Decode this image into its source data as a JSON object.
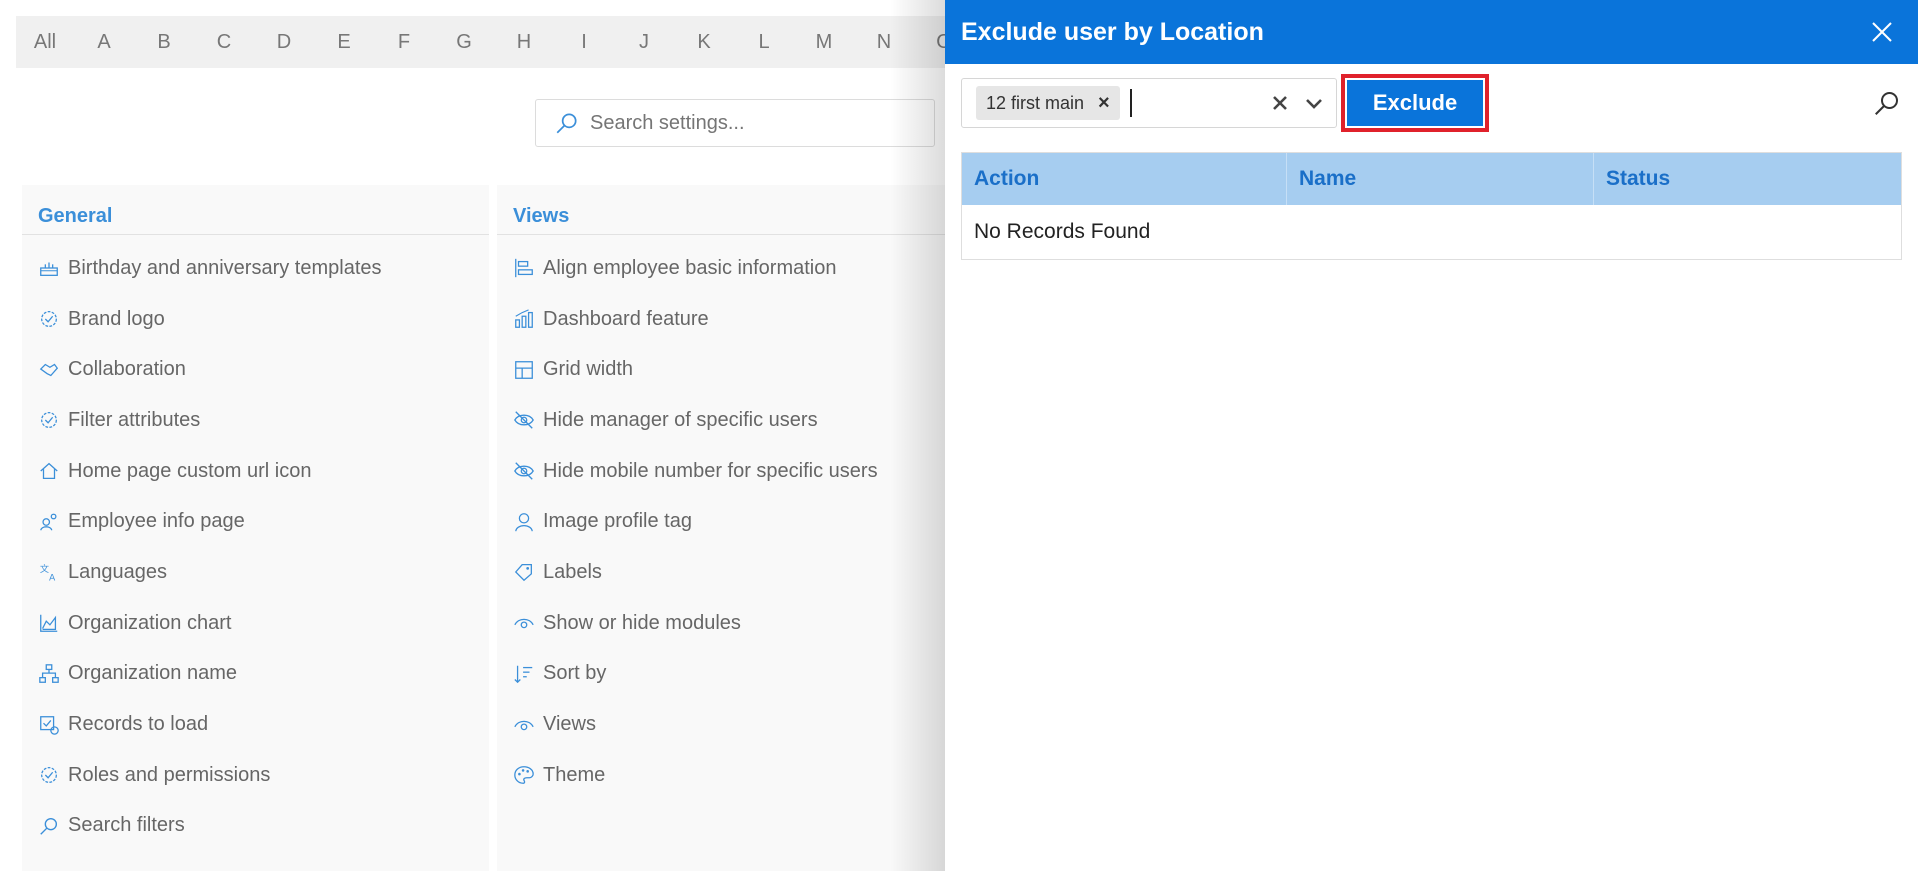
{
  "alphabet": [
    "All",
    "A",
    "B",
    "C",
    "D",
    "E",
    "F",
    "G",
    "H",
    "I",
    "J",
    "K",
    "L",
    "M",
    "N",
    "O"
  ],
  "search": {
    "placeholder": "Search settings..."
  },
  "general": {
    "title": "General",
    "items": [
      {
        "label": "Birthday and anniversary templates",
        "icon": "cake-icon"
      },
      {
        "label": "Brand logo",
        "icon": "badge-check-icon"
      },
      {
        "label": "Collaboration",
        "icon": "handshake-icon"
      },
      {
        "label": "Filter attributes",
        "icon": "badge-check-icon"
      },
      {
        "label": "Home page custom url icon",
        "icon": "home-icon"
      },
      {
        "label": "Employee info page",
        "icon": "people-icon"
      },
      {
        "label": "Languages",
        "icon": "translate-icon"
      },
      {
        "label": "Organization chart",
        "icon": "area-chart-icon"
      },
      {
        "label": "Organization name",
        "icon": "hierarchy-icon"
      },
      {
        "label": "Records to load",
        "icon": "checkbox-sync-icon"
      },
      {
        "label": "Roles and permissions",
        "icon": "badge-check-icon"
      },
      {
        "label": "Search filters",
        "icon": "search-icon"
      }
    ]
  },
  "views": {
    "title": "Views",
    "items": [
      {
        "label": "Align employee basic information",
        "icon": "align-left-icon"
      },
      {
        "label": "Dashboard feature",
        "icon": "bar-chart-icon"
      },
      {
        "label": "Grid width",
        "icon": "table-icon"
      },
      {
        "label": "Hide manager of specific users",
        "icon": "eye-off-icon"
      },
      {
        "label": "Hide mobile number for specific users",
        "icon": "eye-off-icon"
      },
      {
        "label": "Image profile tag",
        "icon": "person-icon"
      },
      {
        "label": "Labels",
        "icon": "tag-icon"
      },
      {
        "label": "Show or hide modules",
        "icon": "eye-icon"
      },
      {
        "label": "Sort by",
        "icon": "sort-icon"
      },
      {
        "label": "Views",
        "icon": "eye-icon"
      },
      {
        "label": "Theme",
        "icon": "palette-icon"
      }
    ]
  },
  "drawer": {
    "title": "Exclude user by Location",
    "chip_label": "12 first main",
    "chip_remove": "×",
    "exclude_label": "Exclude",
    "columns": [
      "Action",
      "Name",
      "Status"
    ],
    "empty_text": "No Records Found"
  },
  "colors": {
    "accent": "#0a74da",
    "link": "#3b8fd9",
    "header_row": "#a6cdf0",
    "highlight": "#e0212b"
  }
}
